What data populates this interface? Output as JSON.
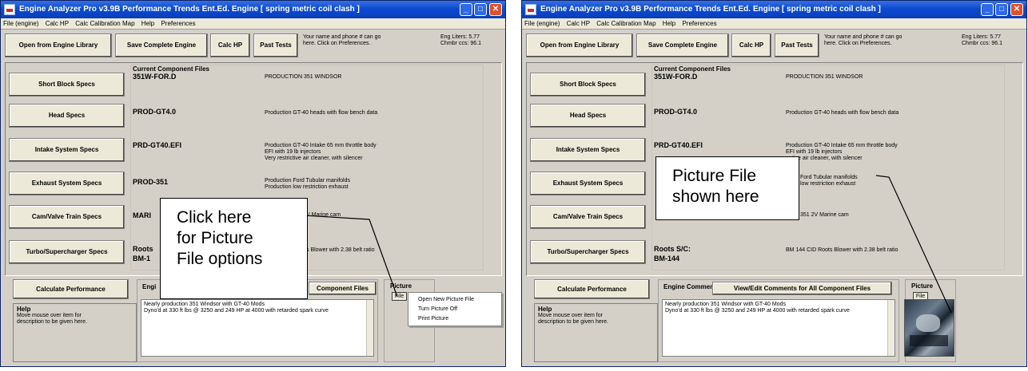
{
  "window": {
    "title": "Engine Analyzer Pro v3.9B   Performance Trends Ent.Ed.       Engine [ spring metric coil clash ]",
    "title_short": "Engine Analyzer Pro v3.9B   Performance Trends Ent.Ed.       Engine [ spring metric coil clash ]",
    "controls": {
      "minimize": "_",
      "maximize": "□",
      "close": "✕"
    }
  },
  "menu": [
    "File (engine)",
    "Calc HP",
    "Calc Calibration Map",
    "Help",
    "Preferences"
  ],
  "toolbar": {
    "open_library": "Open from Engine Library",
    "save_engine": "Save Complete Engine",
    "calc_hp": "Calc HP",
    "past_tests": "Past Tests",
    "note_line1": "Your name and phone # can go",
    "note_line2": "here.  Click on Preferences.",
    "eng_liters": "Eng Liters:  5.77",
    "chmbr_ccs": "Chmbr ccs:  96.1"
  },
  "specs": {
    "current_files_header": "Current Component Files",
    "buttons": [
      "Short Block Specs",
      "Head Specs",
      "Intake System Specs",
      "Exhaust System Specs",
      "Cam/Valve Train Specs",
      "Turbo/Supercharger Specs"
    ],
    "components": [
      {
        "name": "351W-FOR.D",
        "desc": [
          "PRODUCTION 351 WINDSOR"
        ]
      },
      {
        "name": "PROD-GT4.0",
        "desc": [
          "Production GT-40 heads with flow bench data"
        ]
      },
      {
        "name": "PRD-GT40.EFI",
        "desc": [
          "Production GT-40 Intake  65 mm throttle body",
          "EFI with 19 lb injectors",
          "Very restrictive air cleaner, with silencer"
        ]
      },
      {
        "name": "PROD-351",
        "desc": [
          "Production Ford Tubular manifolds",
          "Production low restriction exhaust"
        ]
      },
      {
        "name": "MARI",
        "desc": [
          "V Marine cam"
        ]
      },
      {
        "name": "Roots S/C:",
        "name2": "BM-144",
        "desc": [
          "BM 144 CID Roots Blower with 2.38 belt ratio"
        ]
      }
    ],
    "components_w2": [
      {
        "name": "351W-FOR.D",
        "desc": [
          "PRODUCTION 351 WINDSOR"
        ]
      },
      {
        "name": "PROD-GT4.0",
        "desc": [
          "Production GT-40 heads with flow bench data"
        ]
      },
      {
        "name": "PRD-GT40.EFI",
        "desc": [
          "Production GT-40 Intake  65 mm throttle body",
          "EFI with 19 lb injectors",
          "tive air cleaner, with silencer"
        ]
      },
      {
        "name": "",
        "desc": [
          "Ford Tubular manifolds",
          "low restriction exhaust"
        ]
      },
      {
        "name": "",
        "desc": [
          "351 2V Marine cam"
        ]
      },
      {
        "name": "Roots S/C:",
        "name2": "BM-144",
        "desc": [
          "BM 144 CID Roots Blower with 2.38 belt ratio"
        ]
      }
    ],
    "w1_partial": {
      "roots_prefix": "Roots",
      "bm_prefix": "BM-1",
      "roots_desc": "s Blower with 2.38 belt ratio"
    }
  },
  "lower": {
    "calc_performance": "Calculate Performance",
    "engine_comments_label": "Engine Comments:",
    "engine_comments_partial": "Engi",
    "view_edit_btn": "View/Edit Comments for All Component Files",
    "view_edit_partial": "Component Files",
    "comments_text_line1": "Nearly production 351 Windsor with GT-40 Mods",
    "comments_text_line2": "Dyno'd at 330 ft lbs @ 3250 and 249 HP at 4000 with retarded spark curve",
    "help_title": "Help",
    "help_line1": "Move mouse over item for",
    "help_line2": "description to be given here.",
    "picture_label": "Picture",
    "file_btn": "File"
  },
  "context_menu": [
    "Open New Picture File",
    "Turn Picture Off",
    "Print Picture"
  ],
  "callouts": {
    "left_lines": [
      "Click here",
      "for Picture",
      "File options"
    ],
    "right_lines": [
      "Picture File",
      "shown here"
    ]
  },
  "colors": {
    "titlebar": "#0b4bd2",
    "window_bg": "#d4d0c8",
    "close_btn": "#e0502a"
  }
}
